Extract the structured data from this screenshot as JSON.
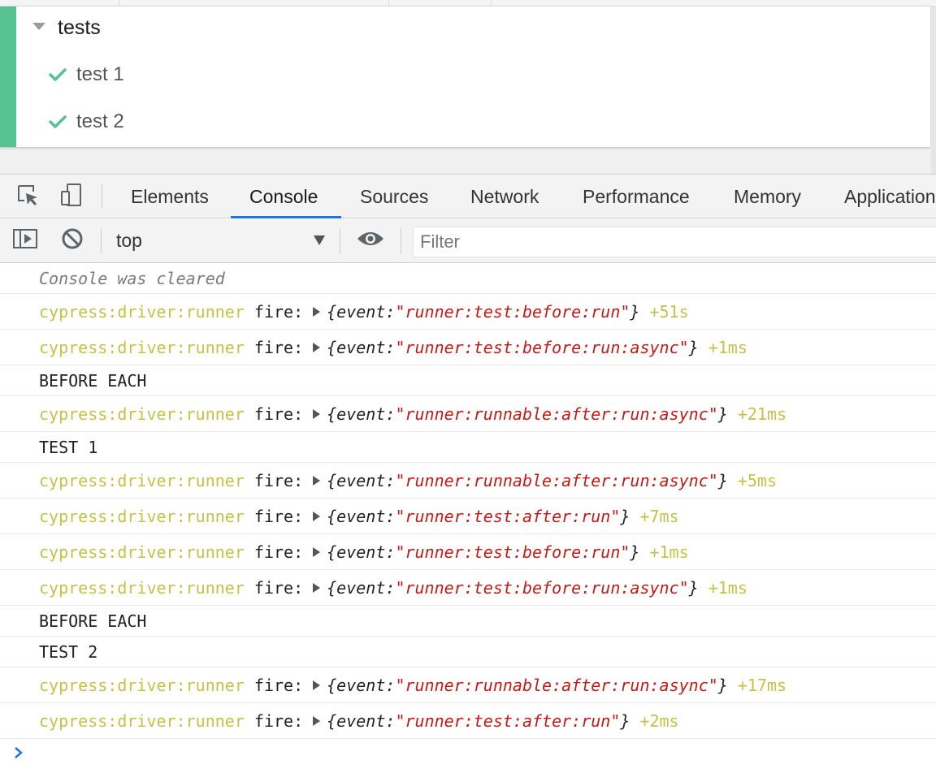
{
  "runner": {
    "suite_title": "tests",
    "tests": [
      {
        "title": "test 1",
        "state": "passed"
      },
      {
        "title": "test 2",
        "state": "passed"
      }
    ],
    "pass_color": "#56c28f"
  },
  "devtools": {
    "tabs": [
      "Elements",
      "Console",
      "Sources",
      "Network",
      "Performance",
      "Memory",
      "Application"
    ],
    "active_tab": "Console",
    "accent_color": "#1a73e8"
  },
  "console_toolbar": {
    "context": "top",
    "filter_placeholder": "Filter"
  },
  "console": {
    "namespace": "cypress:driver:runner",
    "fire_label": "fire:",
    "obj_open": "{event: ",
    "obj_close": "}",
    "messages": [
      {
        "kind": "cleared",
        "text": "Console was cleared"
      },
      {
        "kind": "debug",
        "event": "\"runner:test:before:run\"",
        "delta": "+51s"
      },
      {
        "kind": "debug",
        "event": "\"runner:test:before:run:async\"",
        "delta": "+1ms"
      },
      {
        "kind": "log",
        "text": "BEFORE EACH"
      },
      {
        "kind": "debug",
        "event": "\"runner:runnable:after:run:async\"",
        "delta": "+21ms"
      },
      {
        "kind": "log",
        "text": "TEST 1"
      },
      {
        "kind": "debug",
        "event": "\"runner:runnable:after:run:async\"",
        "delta": "+5ms"
      },
      {
        "kind": "debug",
        "event": "\"runner:test:after:run\"",
        "delta": "+7ms"
      },
      {
        "kind": "debug",
        "event": "\"runner:test:before:run\"",
        "delta": "+1ms"
      },
      {
        "kind": "debug",
        "event": "\"runner:test:before:run:async\"",
        "delta": "+1ms"
      },
      {
        "kind": "log",
        "text": "BEFORE EACH"
      },
      {
        "kind": "log",
        "text": "TEST 2"
      },
      {
        "kind": "debug",
        "event": "\"runner:runnable:after:run:async\"",
        "delta": "+17ms"
      },
      {
        "kind": "debug",
        "event": "\"runner:test:after:run\"",
        "delta": "+2ms"
      }
    ],
    "namespace_color": "#c4c247",
    "string_color": "#c41a16"
  }
}
